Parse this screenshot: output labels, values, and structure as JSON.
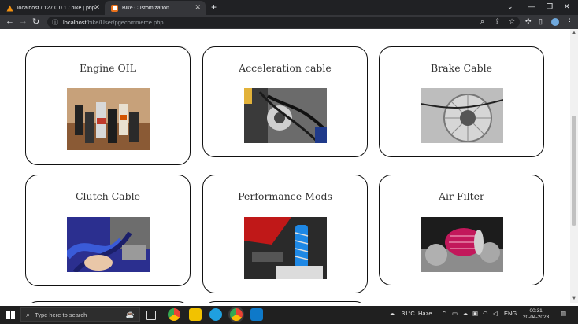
{
  "browser": {
    "tabs": [
      {
        "title": "localhost / 127.0.0.1 / bike | php",
        "active": false
      },
      {
        "title": "Bike Customization",
        "active": true
      }
    ],
    "new_tab_glyph": "+",
    "url_host": "localhost",
    "url_path": "/bike/User/pgecommerce.php"
  },
  "products": [
    {
      "name": "Engine OIL",
      "image_icon": "engine-oil-bottles-image"
    },
    {
      "name": "Acceleration cable",
      "image_icon": "acceleration-cable-image"
    },
    {
      "name": "Brake Cable",
      "image_icon": "brake-cable-image"
    },
    {
      "name": "Clutch Cable",
      "image_icon": "clutch-cable-image"
    },
    {
      "name": "Performance Mods",
      "image_icon": "performance-mods-image"
    },
    {
      "name": "Air Filter",
      "image_icon": "air-filter-image"
    }
  ],
  "taskbar": {
    "search_placeholder": "Type here to search",
    "weather_temp": "31°C",
    "weather_text": "Haze",
    "language": "ENG",
    "time": "00:31",
    "date": "20-04-2023"
  },
  "colors": {
    "chrome_dark": "#202124",
    "chrome_toolbar": "#35363a",
    "card_border": "#111111",
    "taskbar": "#202020"
  }
}
